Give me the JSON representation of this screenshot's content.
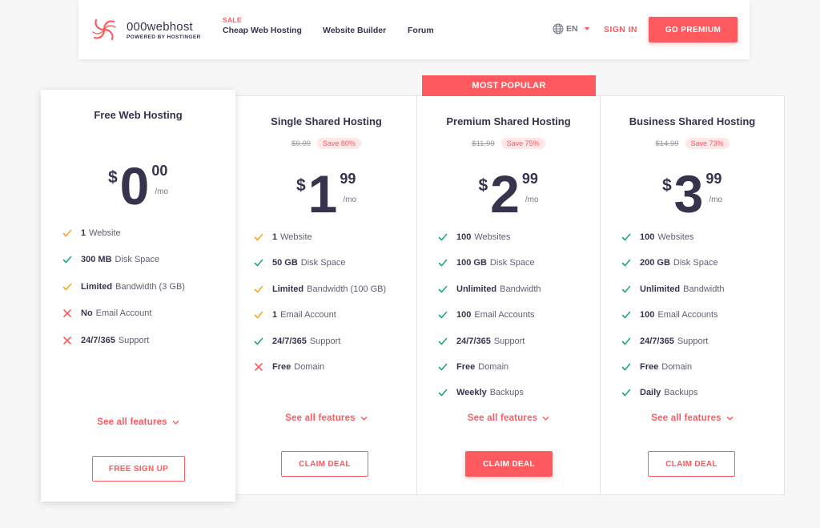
{
  "header": {
    "logo_name": "000webhost",
    "logo_sub": "POWERED BY HOSTINGER",
    "sale_tag": "SALE",
    "nav": [
      "Cheap Web Hosting",
      "Website Builder",
      "Forum"
    ],
    "language": "EN",
    "sign_in": "SIGN IN",
    "go_premium": "GO PREMIUM"
  },
  "popular_label": "MOST POPULAR",
  "colors": {
    "accent": "#ff5a5f",
    "check_green": "#1fa67a",
    "check_orange": "#f5a623",
    "cross_red": "#ff5a5f"
  },
  "plans": [
    {
      "title": "Free Web Hosting",
      "old_price": "",
      "save": "",
      "currency": "$",
      "whole": "0",
      "cents": "00",
      "per": "/mo",
      "features": [
        {
          "status": "partial",
          "bold": "1",
          "text": "Website"
        },
        {
          "status": "yes",
          "bold": "300 MB",
          "text": "Disk Space"
        },
        {
          "status": "partial",
          "bold": "Limited",
          "text": "Bandwidth (3 GB)"
        },
        {
          "status": "no",
          "bold": "No",
          "text": "Email Account"
        },
        {
          "status": "no",
          "bold": "24/7/365",
          "text": "Support"
        }
      ],
      "see_all": "See all features",
      "cta": "FREE SIGN UP"
    },
    {
      "title": "Single Shared Hosting",
      "old_price": "$9.99",
      "save": "Save 80%",
      "currency": "$",
      "whole": "1",
      "cents": "99",
      "per": "/mo",
      "features": [
        {
          "status": "partial",
          "bold": "1",
          "text": "Website"
        },
        {
          "status": "yes",
          "bold": "50 GB",
          "text": "Disk Space"
        },
        {
          "status": "partial",
          "bold": "Limited",
          "text": "Bandwidth (100 GB)"
        },
        {
          "status": "partial",
          "bold": "1",
          "text": "Email Account"
        },
        {
          "status": "yes",
          "bold": "24/7/365",
          "text": "Support"
        },
        {
          "status": "no",
          "bold": "Free",
          "text": "Domain"
        }
      ],
      "see_all": "See all features",
      "cta": "CLAIM DEAL"
    },
    {
      "title": "Premium Shared Hosting",
      "old_price": "$11.99",
      "save": "Save 75%",
      "currency": "$",
      "whole": "2",
      "cents": "99",
      "per": "/mo",
      "features": [
        {
          "status": "yes",
          "bold": "100",
          "text": "Websites"
        },
        {
          "status": "yes",
          "bold": "100 GB",
          "text": "Disk Space"
        },
        {
          "status": "yes",
          "bold": "Unlimited",
          "text": "Bandwidth"
        },
        {
          "status": "yes",
          "bold": "100",
          "text": "Email Accounts"
        },
        {
          "status": "yes",
          "bold": "24/7/365",
          "text": "Support"
        },
        {
          "status": "yes",
          "bold": "Free",
          "text": "Domain"
        },
        {
          "status": "yes",
          "bold": "Weekly",
          "text": "Backups"
        }
      ],
      "see_all": "See all features",
      "cta": "CLAIM DEAL"
    },
    {
      "title": "Business Shared Hosting",
      "old_price": "$14.99",
      "save": "Save 73%",
      "currency": "$",
      "whole": "3",
      "cents": "99",
      "per": "/mo",
      "features": [
        {
          "status": "yes",
          "bold": "100",
          "text": "Websites"
        },
        {
          "status": "yes",
          "bold": "200 GB",
          "text": "Disk Space"
        },
        {
          "status": "yes",
          "bold": "Unlimited",
          "text": "Bandwidth"
        },
        {
          "status": "yes",
          "bold": "100",
          "text": "Email Accounts"
        },
        {
          "status": "yes",
          "bold": "24/7/365",
          "text": "Support"
        },
        {
          "status": "yes",
          "bold": "Free",
          "text": "Domain"
        },
        {
          "status": "yes",
          "bold": "Daily",
          "text": "Backups"
        }
      ],
      "see_all": "See all features",
      "cta": "CLAIM DEAL"
    }
  ]
}
